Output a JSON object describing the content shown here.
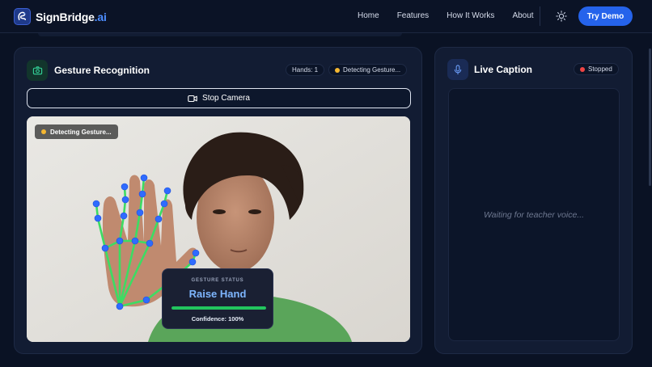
{
  "navbar": {
    "brand": "SignBridge",
    "brand_suffix": ".ai",
    "links": [
      "Home",
      "Features",
      "How It Works",
      "About"
    ],
    "theme_icon": "sun-icon",
    "cta_label": "Try Demo"
  },
  "gesture_panel": {
    "title": "Gesture Recognition",
    "icon": "camera-icon",
    "hands_pill": "Hands: 1",
    "detecting_pill": "Detecting Gesture...",
    "stop_camera_label": "Stop Camera",
    "video_badge": "Detecting Gesture...",
    "status": {
      "label": "GESTURE STATUS",
      "value": "Raise Hand",
      "confidence": 1.0,
      "confidence_text": "Confidence: 100%"
    }
  },
  "caption_panel": {
    "title": "Live Caption",
    "icon": "microphone-icon",
    "state_pill": "Stopped",
    "placeholder": "Waiting for teacher voice..."
  },
  "colors": {
    "accent": "#2563eb",
    "detecting_dot": "#f5b731",
    "stopped_dot": "#ef4444",
    "landmark_point": "#2f6bff",
    "landmark_line": "#3ddc63",
    "confidence_bar": "#22c55e"
  }
}
